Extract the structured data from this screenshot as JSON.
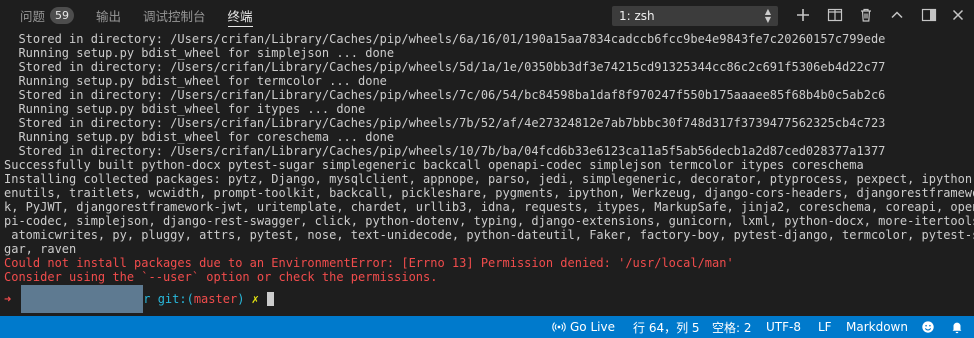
{
  "panel": {
    "tabs": [
      {
        "label": "问题",
        "badge": "59"
      },
      {
        "label": "输出"
      },
      {
        "label": "调试控制台"
      },
      {
        "label": "终端",
        "active": true
      }
    ],
    "terminal_select": "1: zsh",
    "actions": [
      "plus-icon",
      "split-icon",
      "trash-icon",
      "chevron-up-icon",
      "maximize-panel-icon",
      "close-icon"
    ]
  },
  "terminal": {
    "lines": [
      {
        "text": "  Stored in directory: /Users/crifan/Library/Caches/pip/wheels/6a/16/01/190a15aa7834cadccb6fcc9be4e9843fe7c20260157c799ede",
        "kind": "normal"
      },
      {
        "text": "  Running setup.py bdist_wheel for simplejson ... done",
        "kind": "normal"
      },
      {
        "text": "  Stored in directory: /Users/crifan/Library/Caches/pip/wheels/5d/1a/1e/0350bb3df3e74215cd91325344cc86c2c691f5306eb4d22c77",
        "kind": "normal"
      },
      {
        "text": "  Running setup.py bdist_wheel for termcolor ... done",
        "kind": "normal"
      },
      {
        "text": "  Stored in directory: /Users/crifan/Library/Caches/pip/wheels/7c/06/54/bc84598ba1daf8f970247f550b175aaaee85f68b4b0c5ab2c6",
        "kind": "normal"
      },
      {
        "text": "  Running setup.py bdist_wheel for itypes ... done",
        "kind": "normal"
      },
      {
        "text": "  Stored in directory: /Users/crifan/Library/Caches/pip/wheels/7b/52/af/4e27324812e7ab7bbbc30f748d317f3739477562325cb4c723",
        "kind": "normal"
      },
      {
        "text": "  Running setup.py bdist_wheel for coreschema ... done",
        "kind": "normal"
      },
      {
        "text": "  Stored in directory: /Users/crifan/Library/Caches/pip/wheels/10/7b/ba/04fcd6b33e6123ca11a5f5ab56decb1a2d87ced028377a1377",
        "kind": "normal"
      },
      {
        "text": "Successfully built python-docx pytest-sugar simplegeneric backcall openapi-codec simplejson termcolor itypes coreschema",
        "kind": "normal"
      },
      {
        "text": "Installing collected packages: pytz, Django, mysqlclient, appnope, parso, jedi, simplegeneric, decorator, ptyprocess, pexpect, ipython-g",
        "kind": "normal"
      },
      {
        "text": "enutils, traitlets, wcwidth, prompt-toolkit, backcall, pickleshare, pygments, ipython, Werkzeug, django-cors-headers, djangorestframewor",
        "kind": "normal"
      },
      {
        "text": "k, PyJWT, djangorestframework-jwt, uritemplate, chardet, urllib3, idna, requests, itypes, MarkupSafe, jinja2, coreschema, coreapi, opena",
        "kind": "normal"
      },
      {
        "text": "pi-codec, simplejson, django-rest-swagger, click, python-dotenv, typing, django-extensions, gunicorn, lxml, python-docx, more-itertools,",
        "kind": "normal"
      },
      {
        "text": " atomicwrites, py, pluggy, attrs, pytest, nose, text-unidecode, python-dateutil, Faker, factory-boy, pytest-django, termcolor, pytest-su",
        "kind": "normal"
      },
      {
        "text": "gar, raven",
        "kind": "normal"
      },
      {
        "text": "Could not install packages due to an EnvironmentError: [Errno 13] Permission denied: '/usr/local/man'",
        "kind": "error"
      },
      {
        "text": "Consider using the `--user` option or check the permissions.",
        "kind": "error"
      }
    ],
    "prompt": {
      "arrow": "➜",
      "dir_suffix": "r",
      "git_label": "git:(",
      "branch": "master",
      "git_close": ")",
      "dirty_mark": "✗"
    }
  },
  "statusbar": {
    "live_share": "Go Live",
    "position": "行 64，列 5",
    "indent": "空格: 2",
    "encoding": "UTF-8",
    "eol": "LF",
    "language": "Markdown",
    "icons": [
      "broadcast-icon",
      "feedback-smiley-icon",
      "notification-bell-icon"
    ]
  },
  "colors": {
    "statusbar_bg": "#007acc",
    "error_text": "#f14c4c",
    "prompt_cyan": "#29b8db",
    "dirty_yellow": "#e5e510"
  }
}
